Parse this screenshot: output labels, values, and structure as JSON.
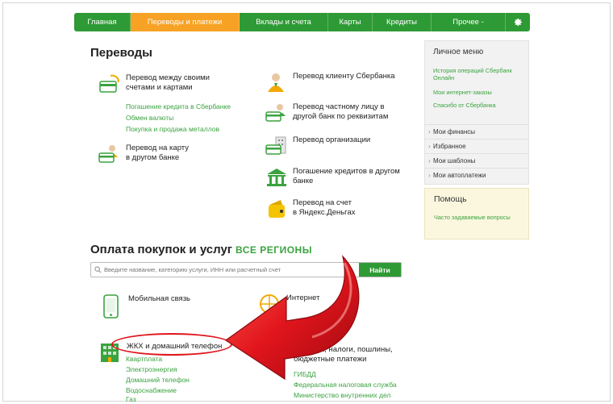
{
  "nav": {
    "items": [
      {
        "label": "Главная"
      },
      {
        "label": "Переводы и платежи"
      },
      {
        "label": "Вклады и счета"
      },
      {
        "label": "Карты"
      },
      {
        "label": "Кредиты"
      },
      {
        "label": "Прочее -"
      }
    ],
    "settings_icon": "gear-icon"
  },
  "transfers": {
    "title": "Переводы",
    "own_accounts": {
      "line1": "Перевод между своими",
      "line2": "счетами и картами"
    },
    "own_links": [
      "Погашение кредита в Сбербанке",
      "Обмен валюты",
      "Покупка и продажа металлов"
    ],
    "card_other_bank": {
      "line1": "Перевод на карту",
      "line2": "в другом банке"
    },
    "sber_client": {
      "line1": "Перевод клиенту Сбербанка"
    },
    "private_person": {
      "line1": "Перевод частному лицу в",
      "line2": "другой банк по реквизитам"
    },
    "organization": {
      "line1": "Перевод организации"
    },
    "loan_other_bank": {
      "line1": "Погашение кредитов в другом",
      "line2": "банке"
    },
    "yandex": {
      "line1": "Перевод на счет",
      "line2": "в Яндекс.Деньгах"
    }
  },
  "payments": {
    "title": "Оплата покупок и услуг",
    "regions": "ВСЕ РЕГИОНЫ",
    "search_placeholder": "Введите название, категорию услуги, ИНН или расчетный счет",
    "search_button": "Найти",
    "mobile": "Мобильная связь",
    "internet": "Интернет",
    "housing": "ЖКХ и домашний телефон",
    "housing_links": [
      "Квартплата",
      "Электроэнергия",
      "Домашний телефон",
      "Водоснабжение",
      "Газ"
    ],
    "taxes": {
      "line1": "Штрафы, налоги, пошлины,",
      "line2": "бюджетные платежи"
    },
    "tax_links": [
      "ГИБДД",
      "Федеральная налоговая служба",
      "Министерство внутренних дел"
    ]
  },
  "sidebar": {
    "title": "Личное меню",
    "links": [
      "История операций Сбербанк Онлайн",
      "Мои интернет-заказы",
      "Спасибо от Сбербанка"
    ],
    "rows": [
      "Мои финансы",
      "Избранное",
      "Мои шаблоны",
      "Мои автоплатежи"
    ]
  },
  "help": {
    "title": "Помощь",
    "link": "Часто задаваемые вопросы"
  },
  "colors": {
    "brand_green": "#2e9a35",
    "active_orange": "#f7a224",
    "link_green": "#3aa33f",
    "arrow_red": "#e0141c"
  }
}
